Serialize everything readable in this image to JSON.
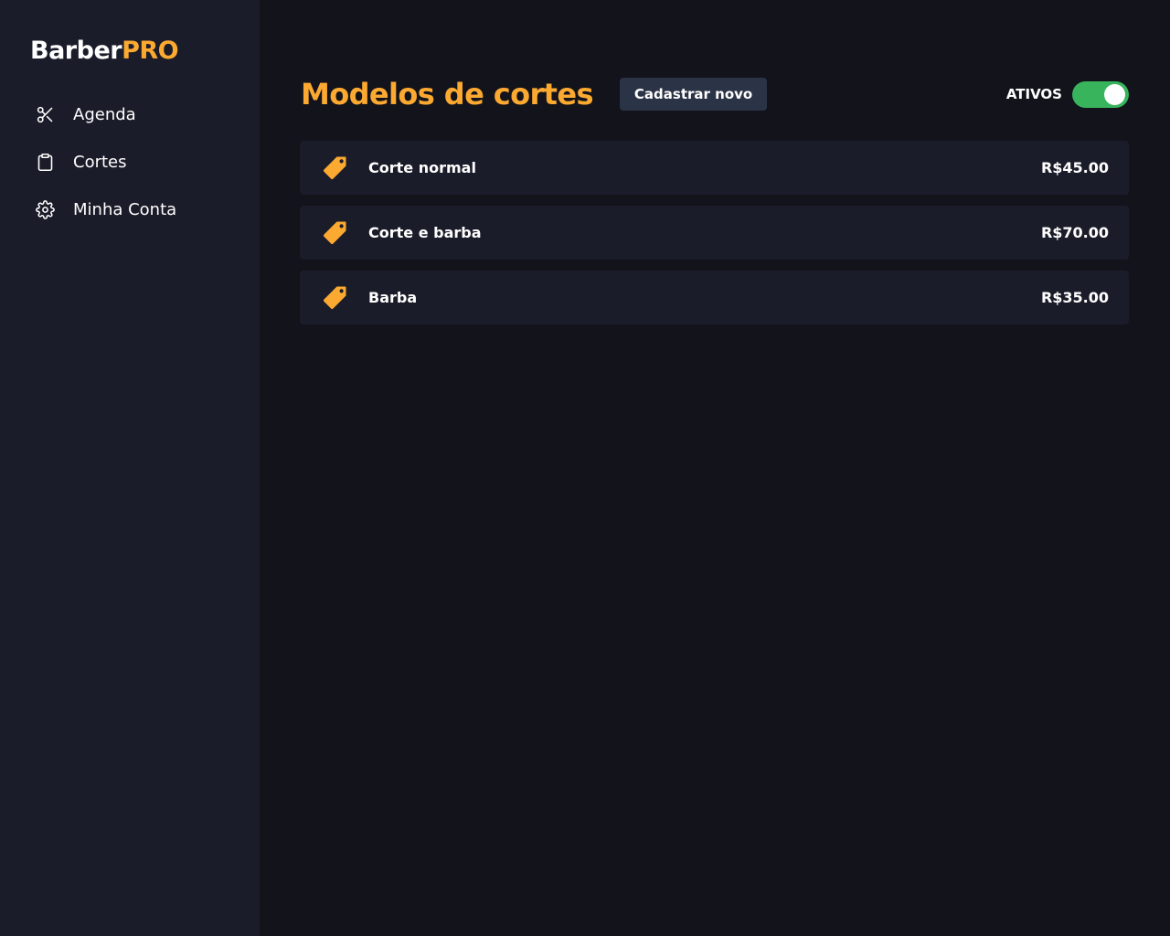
{
  "brand": {
    "name_part1": "Barber",
    "name_part2": "PRO",
    "accent": "#fba931"
  },
  "sidebar": {
    "items": [
      {
        "label": "Agenda",
        "icon": "scissors-icon"
      },
      {
        "label": "Cortes",
        "icon": "clipboard-icon"
      },
      {
        "label": "Minha Conta",
        "icon": "gear-icon"
      }
    ]
  },
  "main": {
    "title": "Modelos de cortes",
    "new_button_label": "Cadastrar novo",
    "toggle": {
      "label": "ATIVOS",
      "on": true,
      "color": "#38b45c"
    },
    "haircuts": [
      {
        "name": "Corte normal",
        "price": "R$45.00",
        "icon": "tag-icon"
      },
      {
        "name": "Corte e barba",
        "price": "R$70.00",
        "icon": "tag-icon"
      },
      {
        "name": "Barba",
        "price": "R$35.00",
        "icon": "tag-icon"
      }
    ]
  }
}
